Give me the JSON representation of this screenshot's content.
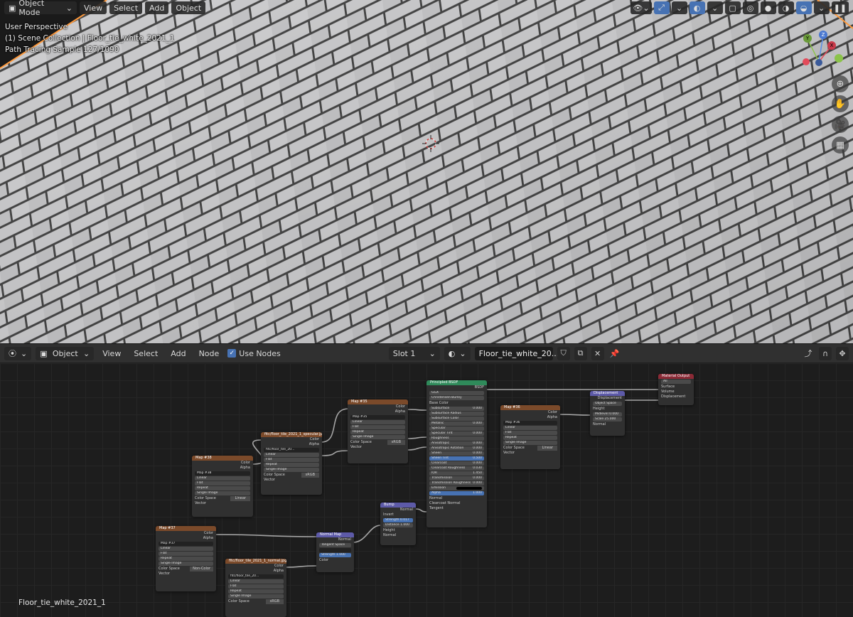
{
  "viewport": {
    "mode_label": "Object Mode",
    "menus": [
      "View",
      "Select",
      "Add",
      "Object"
    ],
    "info_lines": [
      "User Perspective",
      "(1) Scene Collection | Floor_tie_white_2021_1",
      "Path Tracing Sample 127/1090"
    ],
    "gizmo_axes": {
      "x": "X",
      "y": "Y",
      "z": "Z"
    }
  },
  "node_editor": {
    "editor_type": "Object",
    "menus": [
      "View",
      "Select",
      "Add",
      "Node"
    ],
    "use_nodes_label": "Use Nodes",
    "slot_label": "Slot 1",
    "material_name": "Floor_tie_white_20..."
  },
  "status": {
    "object_name": "Floor_tie_white_2021_1"
  },
  "colors": {
    "accent": "#4772b3",
    "texture_header": "#7b4a2a",
    "shader_header": "#2f8a5a",
    "vector_header": "#5d5aa8",
    "output_header": "#8b2a36"
  },
  "nodes": {
    "map38": {
      "title": "Map #38",
      "out1": "Color",
      "out2": "Alpha",
      "image": "Map #38",
      "f1": "Linear",
      "f2": "Flat",
      "f3": "Repeat",
      "f4": "Single Image",
      "cs_label": "Color Space",
      "cs_val": "Linear",
      "vec": "Vector"
    },
    "spec": {
      "title": "fitc/floor_tile_2021_1_specular.jpg",
      "out1": "Color",
      "out2": "Alpha",
      "image": "fitc/floor_tile_20...",
      "f1": "Linear",
      "f2": "Flat",
      "f3": "Repeat",
      "f4": "Single Image",
      "cs_label": "Color Space",
      "cs_val": "sRGB",
      "vec": "Vector"
    },
    "map35": {
      "title": "Map #35",
      "out1": "Color",
      "out2": "Alpha",
      "image": "Map #35",
      "f1": "Linear",
      "f2": "Flat",
      "f3": "Repeat",
      "f4": "Single Image",
      "cs_label": "Color Space",
      "cs_val": "sRGB",
      "vec": "Vector"
    },
    "bsdf": {
      "title": "Principled BSDF",
      "out": "BSDF",
      "f1": "GGX",
      "f2": "Christensen-Burley",
      "inputs": [
        "Base Color",
        "Subsurface",
        "Subsurface Radius",
        "Subsurface Color",
        "Metallic",
        "Specular",
        "Specular Tint",
        "Roughness",
        "Anisotropic",
        "Anisotropic Rotation",
        "Sheen",
        "Sheen Tint",
        "Clearcoat",
        "Clearcoat Roughness",
        "IOR",
        "Transmission",
        "Transmission Roughness",
        "Emission",
        "Alpha",
        "Normal",
        "Clearcoat Normal",
        "Tangent"
      ],
      "values": [
        "",
        "0.000",
        "",
        "",
        "0.000",
        "",
        "0.000",
        "",
        "0.000",
        "0.000",
        "0.000",
        "0.500",
        "0.000",
        "0.030",
        "1.450",
        "0.000",
        "0.000",
        "",
        "1.000",
        "",
        "",
        ""
      ]
    },
    "map36": {
      "title": "Map #36",
      "out1": "Color",
      "out2": "Alpha",
      "image": "Map #36",
      "f1": "Linear",
      "f2": "Flat",
      "f3": "Repeat",
      "f4": "Single Image",
      "cs_label": "Color Space",
      "cs_val": "Linear",
      "vec": "Vector"
    },
    "disp": {
      "title": "Displacement",
      "out": "Displacement",
      "space": "Object Space",
      "in1": "Height",
      "in2": "Midlevel",
      "in2v": "0.000",
      "in3": "Scale",
      "in3v": "25.000",
      "in4": "Normal"
    },
    "output": {
      "title": "Material Output",
      "target": "All",
      "in1": "Surface",
      "in2": "Volume",
      "in3": "Displacement"
    },
    "bump": {
      "title": "Bump",
      "out": "Normal",
      "inv": "Invert",
      "s1": "Strength",
      "s1v": "0.017",
      "s2": "Distance",
      "s2v": "1.000",
      "in1": "Height",
      "in2": "Normal"
    },
    "map37": {
      "title": "Map #37",
      "out1": "Color",
      "out2": "Alpha",
      "image": "Map #37",
      "f1": "Linear",
      "f2": "Flat",
      "f3": "Repeat",
      "f4": "Single Image",
      "cs_label": "Color Space",
      "cs_val": "Non-Color",
      "vec": "Vector"
    },
    "nmap": {
      "title": "Normal Map",
      "out": "Normal",
      "space": "Tangent Space",
      "s1": "Strength",
      "s1v": "1.000",
      "in1": "Color"
    },
    "normtex": {
      "title": "fitc/floor_tile_2021_1_normal.jpg",
      "out1": "Color",
      "out2": "Alpha",
      "image": "fitc/floor_tile_20...",
      "f1": "Linear",
      "f2": "Flat",
      "f3": "Repeat",
      "f4": "Single Image",
      "cs_label": "Color Space",
      "cs_val": "sRGB"
    }
  }
}
